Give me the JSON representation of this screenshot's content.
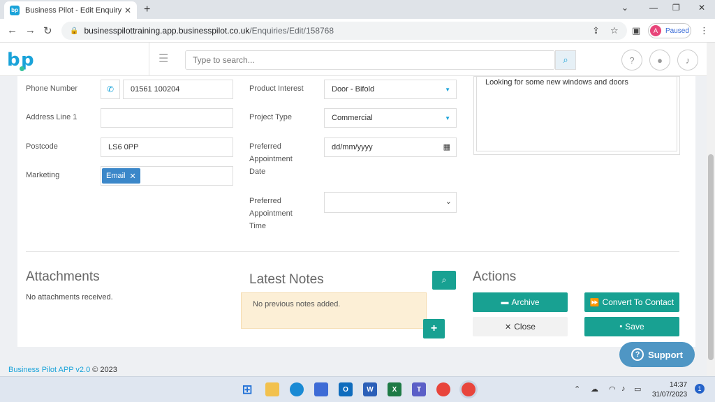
{
  "browser": {
    "tab_title": "Business Pilot - Edit Enquiry",
    "favicon_text": "bp",
    "url_host": "businesspilottraining.app.businesspilot.co.uk",
    "url_path": "/Enquiries/Edit/158768",
    "profile_initial": "A",
    "profile_status": "Paused"
  },
  "header": {
    "search_placeholder": "Type to search...",
    "help_label": "?"
  },
  "form": {
    "phone_label": "Phone Number",
    "phone_value": "01561 100204",
    "address1_label": "Address Line 1",
    "address1_value": "",
    "postcode_label": "Postcode",
    "postcode_value": "LS6 0PP",
    "marketing_label": "Marketing",
    "marketing_tag": "Email",
    "product_interest_label": "Product Interest",
    "product_interest_value": "Door - Bifold",
    "project_type_label": "Project Type",
    "project_type_value": "Commercial",
    "appt_date_label": "Preferred Appointment Date",
    "appt_date_value": "dd/mm/yyyy",
    "appt_time_label": "Preferred Appointment Time",
    "appt_time_value": "",
    "notes_value": "Looking for some new windows and doors"
  },
  "attachments": {
    "title": "Attachments",
    "empty_text": "No attachments received."
  },
  "latest_notes": {
    "title": "Latest Notes",
    "empty_text": "No previous notes added.",
    "add_label": "+"
  },
  "actions": {
    "title": "Actions",
    "archive_label": "Archive",
    "convert_label": "Convert To Contact",
    "close_label": "Close",
    "save_label": "Save"
  },
  "footer": {
    "app_version": "Business Pilot APP v2.0",
    "copyright": "© 2023"
  },
  "support_label": "Support",
  "taskbar": {
    "time": "14:37",
    "date": "31/07/2023",
    "notification_count": "1"
  },
  "colors": {
    "brand": "#1aa3d9",
    "teal": "#18a192",
    "tag_blue": "#3b87c9",
    "notes_bg": "#fcefd6",
    "support_bg": "#4f96c4"
  }
}
